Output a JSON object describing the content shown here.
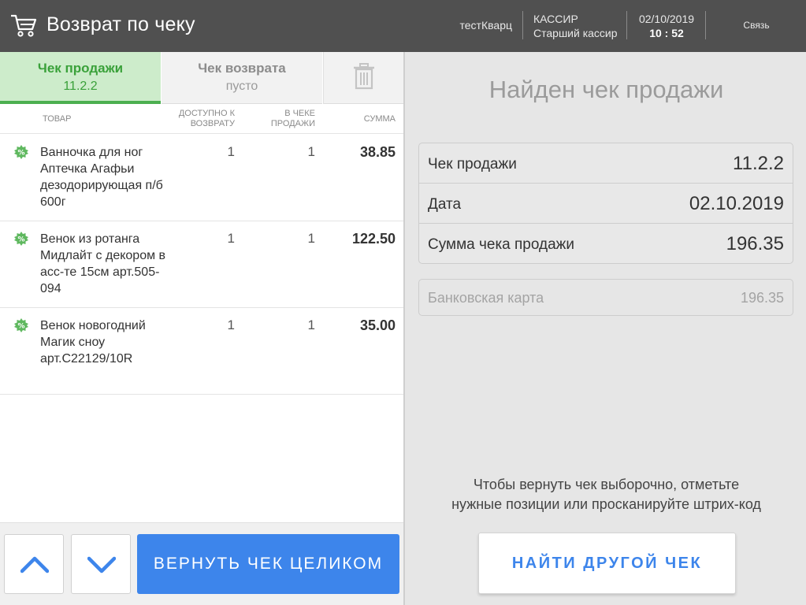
{
  "header": {
    "title": "Возврат по чеку",
    "shop": "тестКварц",
    "cashier_role": "КАССИР",
    "cashier_name": "Старший кассир",
    "date": "02/10/2019",
    "time": "10 : 52",
    "connection": "Связь"
  },
  "tabs": {
    "sale_title": "Чек продажи",
    "sale_value": "11.2.2",
    "return_title": "Чек возврата",
    "return_value": "пусто"
  },
  "columns": {
    "goods": "ТОВАР",
    "available": "ДОСТУПНО К ВОЗВРАТУ",
    "in_receipt": "В ЧЕКЕ ПРОДАЖИ",
    "sum": "СУММА"
  },
  "items": [
    {
      "name": "Ванночка для ног Аптечка Агафьи дезодорирующая п/б 600г",
      "available": "1",
      "in_receipt": "1",
      "sum": "38.85"
    },
    {
      "name": "Венок из ротанга Мидлайт с декором в асс-те 15см арт.505-094",
      "available": "1",
      "in_receipt": "1",
      "sum": "122.50"
    },
    {
      "name": "Венок новогодний Магик сноу арт.С22129/10R",
      "available": "1",
      "in_receipt": "1",
      "sum": "35.00"
    }
  ],
  "buttons": {
    "return_all": "ВЕРНУТЬ ЧЕК ЦЕЛИКОМ",
    "find_other": "НАЙТИ ДРУГОЙ ЧЕК"
  },
  "right": {
    "found_title": "Найден чек продажи",
    "receipt_label": "Чек продажи",
    "receipt_value": "11.2.2",
    "date_label": "Дата",
    "date_value": "02.10.2019",
    "total_label": "Сумма чека продажи",
    "total_value": "196.35",
    "payment_label": "Банковская карта",
    "payment_value": "196.35",
    "hint_line1": "Чтобы вернуть чек выборочно, отметьте",
    "hint_line2": "нужные позиции или просканируйте штрих-код"
  },
  "colors": {
    "header_bg": "#505050",
    "accent_green": "#4caf50",
    "accent_blue": "#3d85eb"
  },
  "icons": [
    "cart-icon",
    "trash-icon",
    "discount-badge-icon",
    "arrow-up-icon",
    "arrow-down-icon"
  ]
}
